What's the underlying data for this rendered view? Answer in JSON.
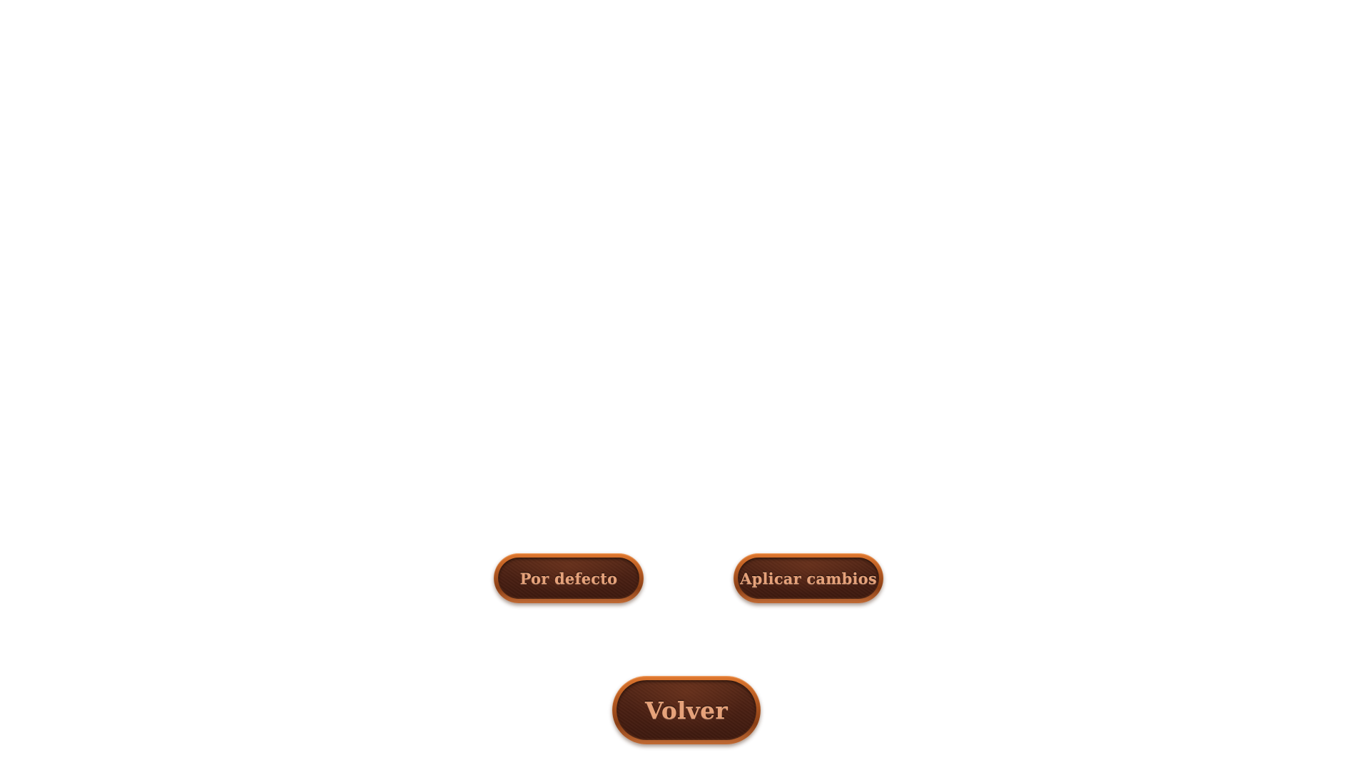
{
  "settings_footer": {
    "defaults_label": "Por defecto",
    "apply_label": "Aplicar cambios",
    "back_label": "Volver"
  },
  "theme": {
    "background": "#ffffff",
    "button_rim": "#b55a22",
    "button_face": "#4a2013",
    "button_text": "#e6a27a"
  }
}
